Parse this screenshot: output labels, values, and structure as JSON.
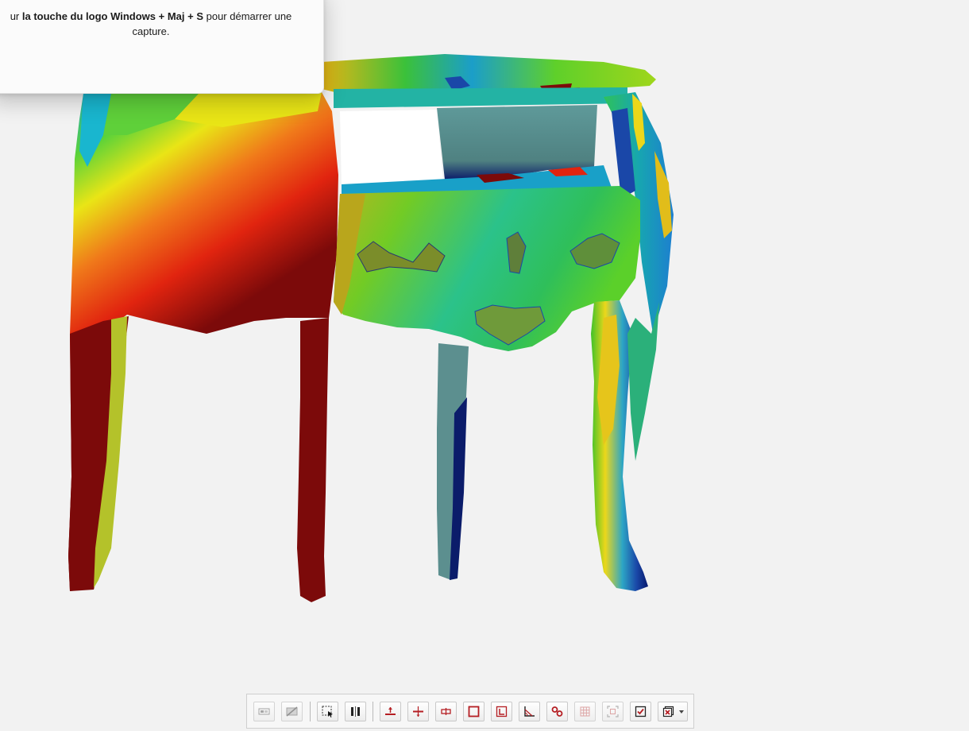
{
  "notification": {
    "message_prefix": "ur ",
    "message_bold": "la touche du logo Windows + Maj + S",
    "message_suffix": " pour démarrer une capture."
  },
  "viewport": {
    "subject": "3d-scanned-commode-deviation-heatmap",
    "colors": {
      "background": "#f2f2f2",
      "dark_red": "#7c0a0a",
      "red": "#e8230e",
      "orange": "#f27a12",
      "yellow": "#f0e312",
      "green": "#3fc229",
      "teal": "#1d8a86",
      "blue": "#1a47a8",
      "dark_blue": "#081a6e",
      "shadow_grey": "#5c7f80"
    }
  },
  "toolbar": {
    "accent": "#b51e23",
    "buttons": [
      {
        "icon": "panel-toggle-icon",
        "enabled": false
      },
      {
        "icon": "hide-slash-icon",
        "enabled": false
      },
      {
        "icon": "select-region-icon",
        "enabled": true
      },
      {
        "icon": "split-view-icon",
        "enabled": true
      },
      {
        "icon": "plane-align-icon",
        "enabled": true
      },
      {
        "icon": "cut-plane-icon",
        "enabled": true
      },
      {
        "icon": "section-icon",
        "enabled": true
      },
      {
        "icon": "rectangle-icon",
        "enabled": true
      },
      {
        "icon": "frame-measure-icon",
        "enabled": true
      },
      {
        "icon": "angle-measure-icon",
        "enabled": true
      },
      {
        "icon": "link-points-icon",
        "enabled": true
      },
      {
        "icon": "grid-icon",
        "enabled": false
      },
      {
        "icon": "bounding-box-icon",
        "enabled": false
      },
      {
        "icon": "check-box-icon",
        "enabled": true
      },
      {
        "icon": "delete-dropdown-icon",
        "enabled": true
      }
    ]
  }
}
